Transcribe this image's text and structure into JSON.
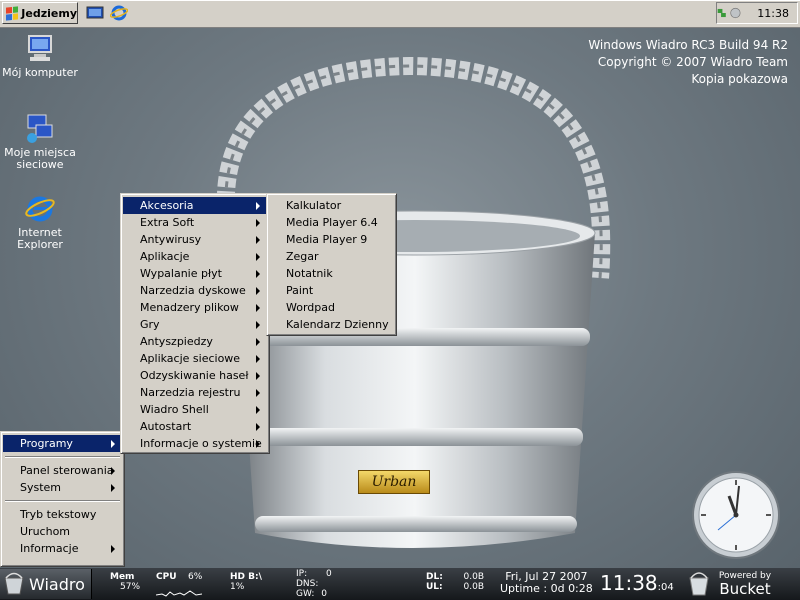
{
  "topbar": {
    "start_label": "Jedziemy",
    "quicklaunch": [
      "desktop-icon",
      "internet-explorer-icon"
    ],
    "tray_icons": [
      "network-icon",
      "volume-icon"
    ],
    "clock": "11:38"
  },
  "watermark": {
    "line1": "Windows Wiadro RC3 Build 94 R2",
    "line2": "Copyright © 2007 Wiadro Team",
    "line3": "Kopia pokazowa"
  },
  "desktop_icons": [
    {
      "label": "Mój komputer",
      "icon": "my-computer-icon"
    },
    {
      "label": "Moje miejsca sieciowe",
      "icon": "network-places-icon"
    },
    {
      "label": "Internet Explorer",
      "icon": "internet-explorer-icon"
    }
  ],
  "start_menu": {
    "items": [
      {
        "label": "Programy",
        "submenu": true,
        "selected": true
      },
      {
        "label": "Panel sterowania",
        "submenu": true
      },
      {
        "label": "System",
        "submenu": true
      },
      {
        "label": "Tryb tekstowy",
        "submenu": false
      },
      {
        "label": "Uruchom",
        "submenu": false
      },
      {
        "label": "Informacje",
        "submenu": true
      }
    ]
  },
  "programs_menu": {
    "items": [
      "Akcesoria",
      "Extra Soft",
      "Antywirusy",
      "Aplikacje",
      "Wypalanie płyt",
      "Narzedzia dyskowe",
      "Menadzery plikow",
      "Gry",
      "Antyszpiedzy",
      "Aplikacje sieciowe",
      "Odzyskiwanie haseł",
      "Narzedzia rejestru",
      "Wiadro Shell",
      "Autostart",
      "Informacje o systemie"
    ],
    "selected": "Akcesoria"
  },
  "accessories_menu": {
    "items": [
      "Kalkulator",
      "Media Player 6.4",
      "Media Player 9",
      "Zegar",
      "Notatnik",
      "Paint",
      "Wordpad",
      "Kalendarz Dzienny"
    ]
  },
  "wallpaper": {
    "plate_text": "Urban"
  },
  "bottombar": {
    "wiadro_label": "Wiadro",
    "mem_label": "Mem",
    "mem_value": "57%",
    "cpu_label": "CPU",
    "cpu_value": "6%",
    "hd_label": "HD B:\\",
    "hd_value": "1%",
    "ip_label": "IP:",
    "ip_value": "0",
    "dns_label": "DNS:",
    "gw_label": "GW:",
    "gw_value": "0",
    "dl_label": "DL:",
    "dl_value": "0.0B",
    "ul_label": "UL:",
    "ul_value": "0.0B",
    "date": "Fri, Jul 27 2007",
    "uptime": "Uptime : 0d 0:28",
    "time": "11:38",
    "seconds": ":04",
    "powered_by": "Powered by",
    "bucket": "Bucket"
  },
  "colors": {
    "menu_bg": "#d4d0c8",
    "selection": "#0a246a",
    "taskbar": "#2a2e33"
  }
}
